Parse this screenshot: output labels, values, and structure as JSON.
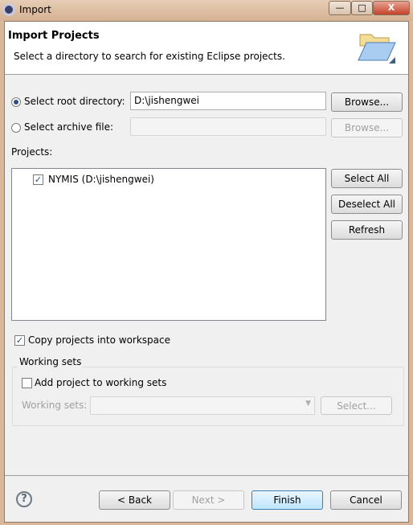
{
  "window": {
    "title": "Import",
    "buttons": {
      "minimize": "—",
      "maximize": "□",
      "close": "X"
    }
  },
  "header": {
    "title": "Import Projects",
    "description": "Select a directory to search for existing Eclipse projects.",
    "icon": "open-folder-icon"
  },
  "source": {
    "root_label": "Select root directory:",
    "root_selected": true,
    "root_value": "D:\\jishengwei",
    "root_browse": "Browse...",
    "archive_label": "Select archive file:",
    "archive_selected": false,
    "archive_value": "",
    "archive_browse": "Browse..."
  },
  "projects": {
    "label": "Projects:",
    "items": [
      {
        "label": "NYMIS (D:\\jishengwei)",
        "checked": true
      }
    ],
    "select_all": "Select All",
    "deselect_all": "Deselect All",
    "refresh": "Refresh"
  },
  "copy": {
    "label": "Copy projects into workspace",
    "checked": true
  },
  "working_sets": {
    "legend": "Working sets",
    "add_label": "Add project to working sets",
    "add_checked": false,
    "field_label": "Working sets:",
    "value": "",
    "select": "Select..."
  },
  "footer": {
    "back": "< Back",
    "next": "Next >",
    "finish": "Finish",
    "cancel": "Cancel",
    "help": "?"
  }
}
